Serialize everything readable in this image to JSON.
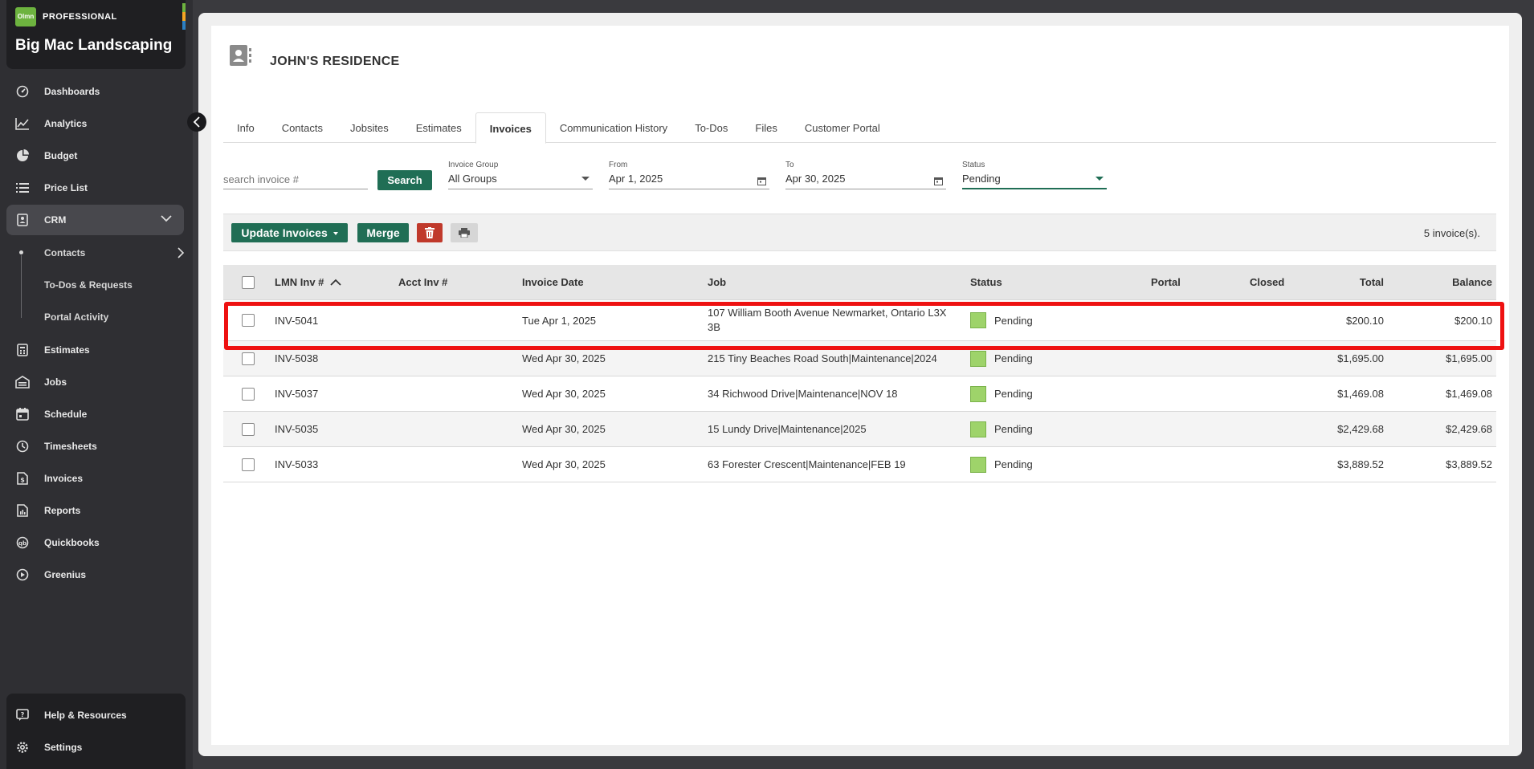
{
  "brand": {
    "logo_text": "Olmn",
    "plan": "PROFESSIONAL",
    "company": "Big Mac Landscaping",
    "bar_colors": [
      "#6db33f",
      "#f5a623",
      "#2d7fc1"
    ]
  },
  "sidebar": {
    "items": [
      {
        "label": "Dashboards",
        "icon": "dashboard-icon"
      },
      {
        "label": "Analytics",
        "icon": "analytics-icon"
      },
      {
        "label": "Budget",
        "icon": "budget-icon"
      },
      {
        "label": "Price List",
        "icon": "price-list-icon"
      },
      {
        "label": "CRM",
        "icon": "crm-icon"
      },
      {
        "label": "Estimates",
        "icon": "estimates-icon"
      },
      {
        "label": "Jobs",
        "icon": "jobs-icon"
      },
      {
        "label": "Schedule",
        "icon": "schedule-icon"
      },
      {
        "label": "Timesheets",
        "icon": "timesheets-icon"
      },
      {
        "label": "Invoices",
        "icon": "invoices-icon"
      },
      {
        "label": "Reports",
        "icon": "reports-icon"
      },
      {
        "label": "Quickbooks",
        "icon": "quickbooks-icon"
      },
      {
        "label": "Greenius",
        "icon": "greenius-icon"
      }
    ],
    "crm_sub": [
      "Contacts",
      "To-Dos & Requests",
      "Portal Activity"
    ],
    "bottom": [
      {
        "label": "Help & Resources",
        "icon": "help-icon"
      },
      {
        "label": "Settings",
        "icon": "settings-icon"
      }
    ]
  },
  "header": {
    "title": "JOHN'S RESIDENCE"
  },
  "tabs": [
    "Info",
    "Contacts",
    "Jobsites",
    "Estimates",
    "Invoices",
    "Communication History",
    "To-Dos",
    "Files",
    "Customer Portal"
  ],
  "active_tab": "Invoices",
  "filters": {
    "search_placeholder": "search invoice #",
    "search_button": "Search",
    "group_label": "Invoice Group",
    "group_value": "All Groups",
    "from_label": "From",
    "from_value": "Apr 1, 2025",
    "to_label": "To",
    "to_value": "Apr 30, 2025",
    "status_label": "Status",
    "status_value": "Pending"
  },
  "toolbar": {
    "update_label": "Update Invoices",
    "merge_label": "Merge",
    "count_text": "5 invoice(s)."
  },
  "table": {
    "columns": [
      "LMN Inv #",
      "Acct Inv #",
      "Invoice Date",
      "Job",
      "Status",
      "Portal",
      "Closed",
      "Total",
      "Balance"
    ],
    "rows": [
      {
        "inv": "INV-5041",
        "acct": "",
        "date": "Tue Apr 1, 2025",
        "job": "107 William Booth Avenue Newmarket, Ontario L3X 3B",
        "status": "Pending",
        "portal": "",
        "closed": "",
        "total": "$200.10",
        "balance": "$200.10"
      },
      {
        "inv": "INV-5038",
        "acct": "",
        "date": "Wed Apr 30, 2025",
        "job": "215 Tiny Beaches Road South|Maintenance|2024",
        "status": "Pending",
        "portal": "",
        "closed": "",
        "total": "$1,695.00",
        "balance": "$1,695.00"
      },
      {
        "inv": "INV-5037",
        "acct": "",
        "date": "Wed Apr 30, 2025",
        "job": "34 Richwood Drive|Maintenance|NOV 18",
        "status": "Pending",
        "portal": "",
        "closed": "",
        "total": "$1,469.08",
        "balance": "$1,469.08"
      },
      {
        "inv": "INV-5035",
        "acct": "",
        "date": "Wed Apr 30, 2025",
        "job": "15 Lundy Drive|Maintenance|2025",
        "status": "Pending",
        "portal": "",
        "closed": "",
        "total": "$2,429.68",
        "balance": "$2,429.68"
      },
      {
        "inv": "INV-5033",
        "acct": "",
        "date": "Wed Apr 30, 2025",
        "job": "63 Forester Crescent|Maintenance|FEB 19",
        "status": "Pending",
        "portal": "",
        "closed": "",
        "total": "$3,889.52",
        "balance": "$3,889.52"
      }
    ]
  },
  "colors": {
    "accent": "#206e55",
    "pending": "#9ed36a",
    "highlight": "#ee1111",
    "danger": "#c0392b"
  }
}
